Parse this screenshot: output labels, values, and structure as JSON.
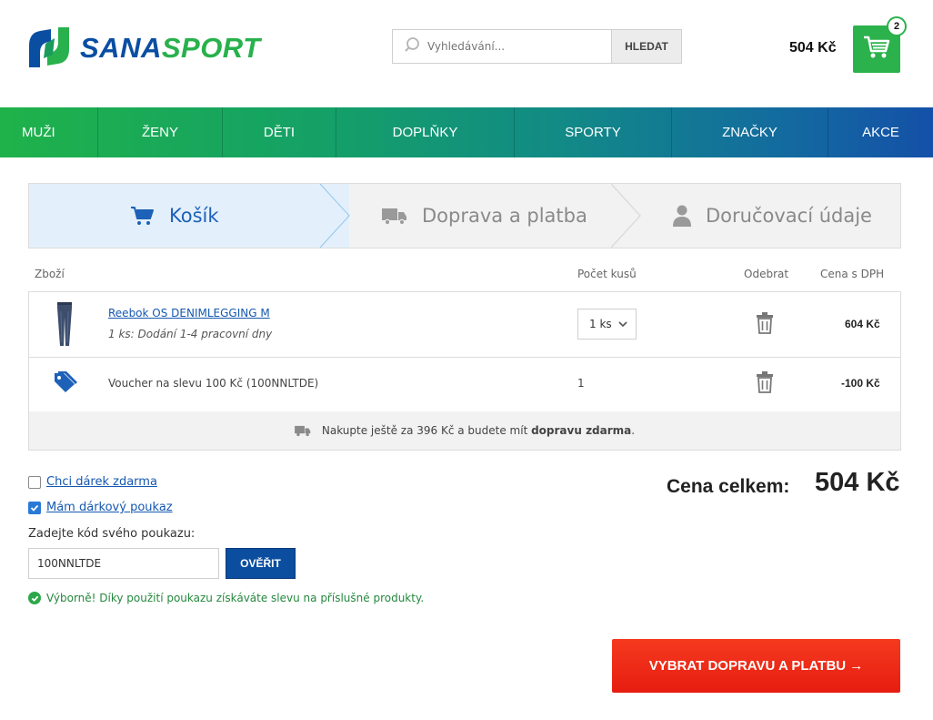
{
  "brand": {
    "name_part1": "SANA",
    "name_part2": "SPORT",
    "blue": "#0a4ea2",
    "green": "#28b14c"
  },
  "header": {
    "search_placeholder": "Vyhledávání...",
    "search_button": "HLEDAT",
    "cart_total": "504 Kč",
    "cart_count": "2",
    "search_icon": "search-icon",
    "cart_icon": "cart-icon"
  },
  "nav": {
    "items": [
      {
        "label": "MUŽI"
      },
      {
        "label": "ŽENY"
      },
      {
        "label": "DĚTI"
      },
      {
        "label": "DOPLŇKY"
      },
      {
        "label": "SPORTY"
      },
      {
        "label": "ZNAČKY"
      },
      {
        "label": "AKCE"
      }
    ]
  },
  "steps": [
    {
      "label": "Košík",
      "icon": "cart-icon",
      "active": true
    },
    {
      "label": "Doprava a platba",
      "icon": "truck-icon",
      "active": false
    },
    {
      "label": "Doručovací údaje",
      "icon": "user-icon",
      "active": false
    }
  ],
  "table": {
    "headers": {
      "item": "Zboží",
      "qty": "Počet kusů",
      "remove": "Odebrat",
      "price": "Cena s DPH"
    },
    "product": {
      "name": "Reebok OS DENIMLEGGING M",
      "delivery": "1 ks: Dodání 1-4 pracovní dny",
      "qty": "1 ks",
      "price": "604 Kč"
    },
    "voucher": {
      "name": "Voucher na slevu 100 Kč (100NNLTDE)",
      "qty": "1",
      "price": "-100 Kč"
    },
    "shipping_note": {
      "prefix": "Nakupte ještě za 396 Kč a budete mít ",
      "bold": "dopravu zdarma",
      "suffix": "."
    }
  },
  "options": {
    "gift_label": "Chci dárek zdarma",
    "gift_checked": false,
    "voucher_label": "Mám dárkový poukaz",
    "voucher_checked": true,
    "code_label": "Zadejte kód svého poukazu:",
    "code_value": "100NNLTDE",
    "verify_button": "OVĚŘIT",
    "success_message": "Výborně! Díky použití poukazu získáváte slevu na příslušné produkty."
  },
  "summary": {
    "total_label": "Cena celkem:",
    "total_value": "504 Kč"
  },
  "cta": {
    "label": "VYBRAT DOPRAVU A PLATBU →",
    "color": "#e61d10"
  }
}
